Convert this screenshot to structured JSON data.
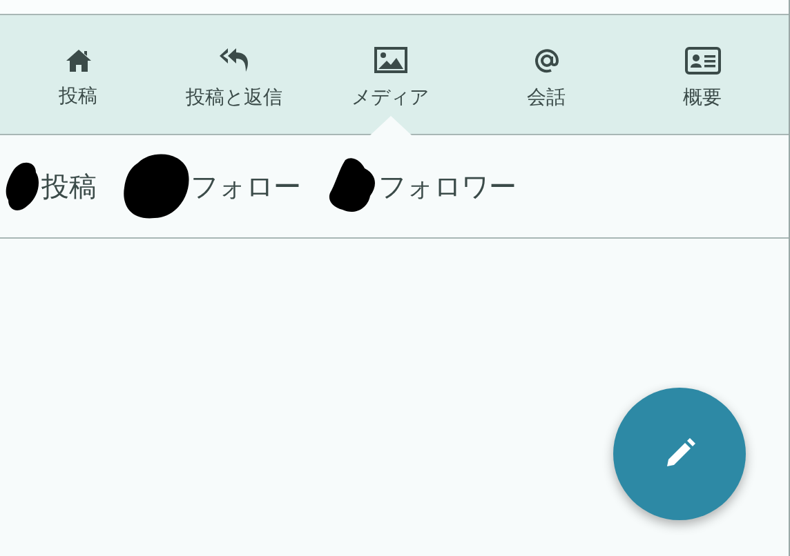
{
  "tabs": [
    {
      "label": "投稿",
      "kind": "home",
      "selected": false
    },
    {
      "label": "投稿と返信",
      "kind": "reply",
      "selected": false
    },
    {
      "label": "メディア",
      "kind": "image",
      "selected": true
    },
    {
      "label": "会話",
      "kind": "at",
      "selected": false
    },
    {
      "label": "概要",
      "kind": "card",
      "selected": false
    }
  ],
  "stats": [
    {
      "label": "投稿"
    },
    {
      "label": "フォロー"
    },
    {
      "label": "フォロワー"
    }
  ]
}
